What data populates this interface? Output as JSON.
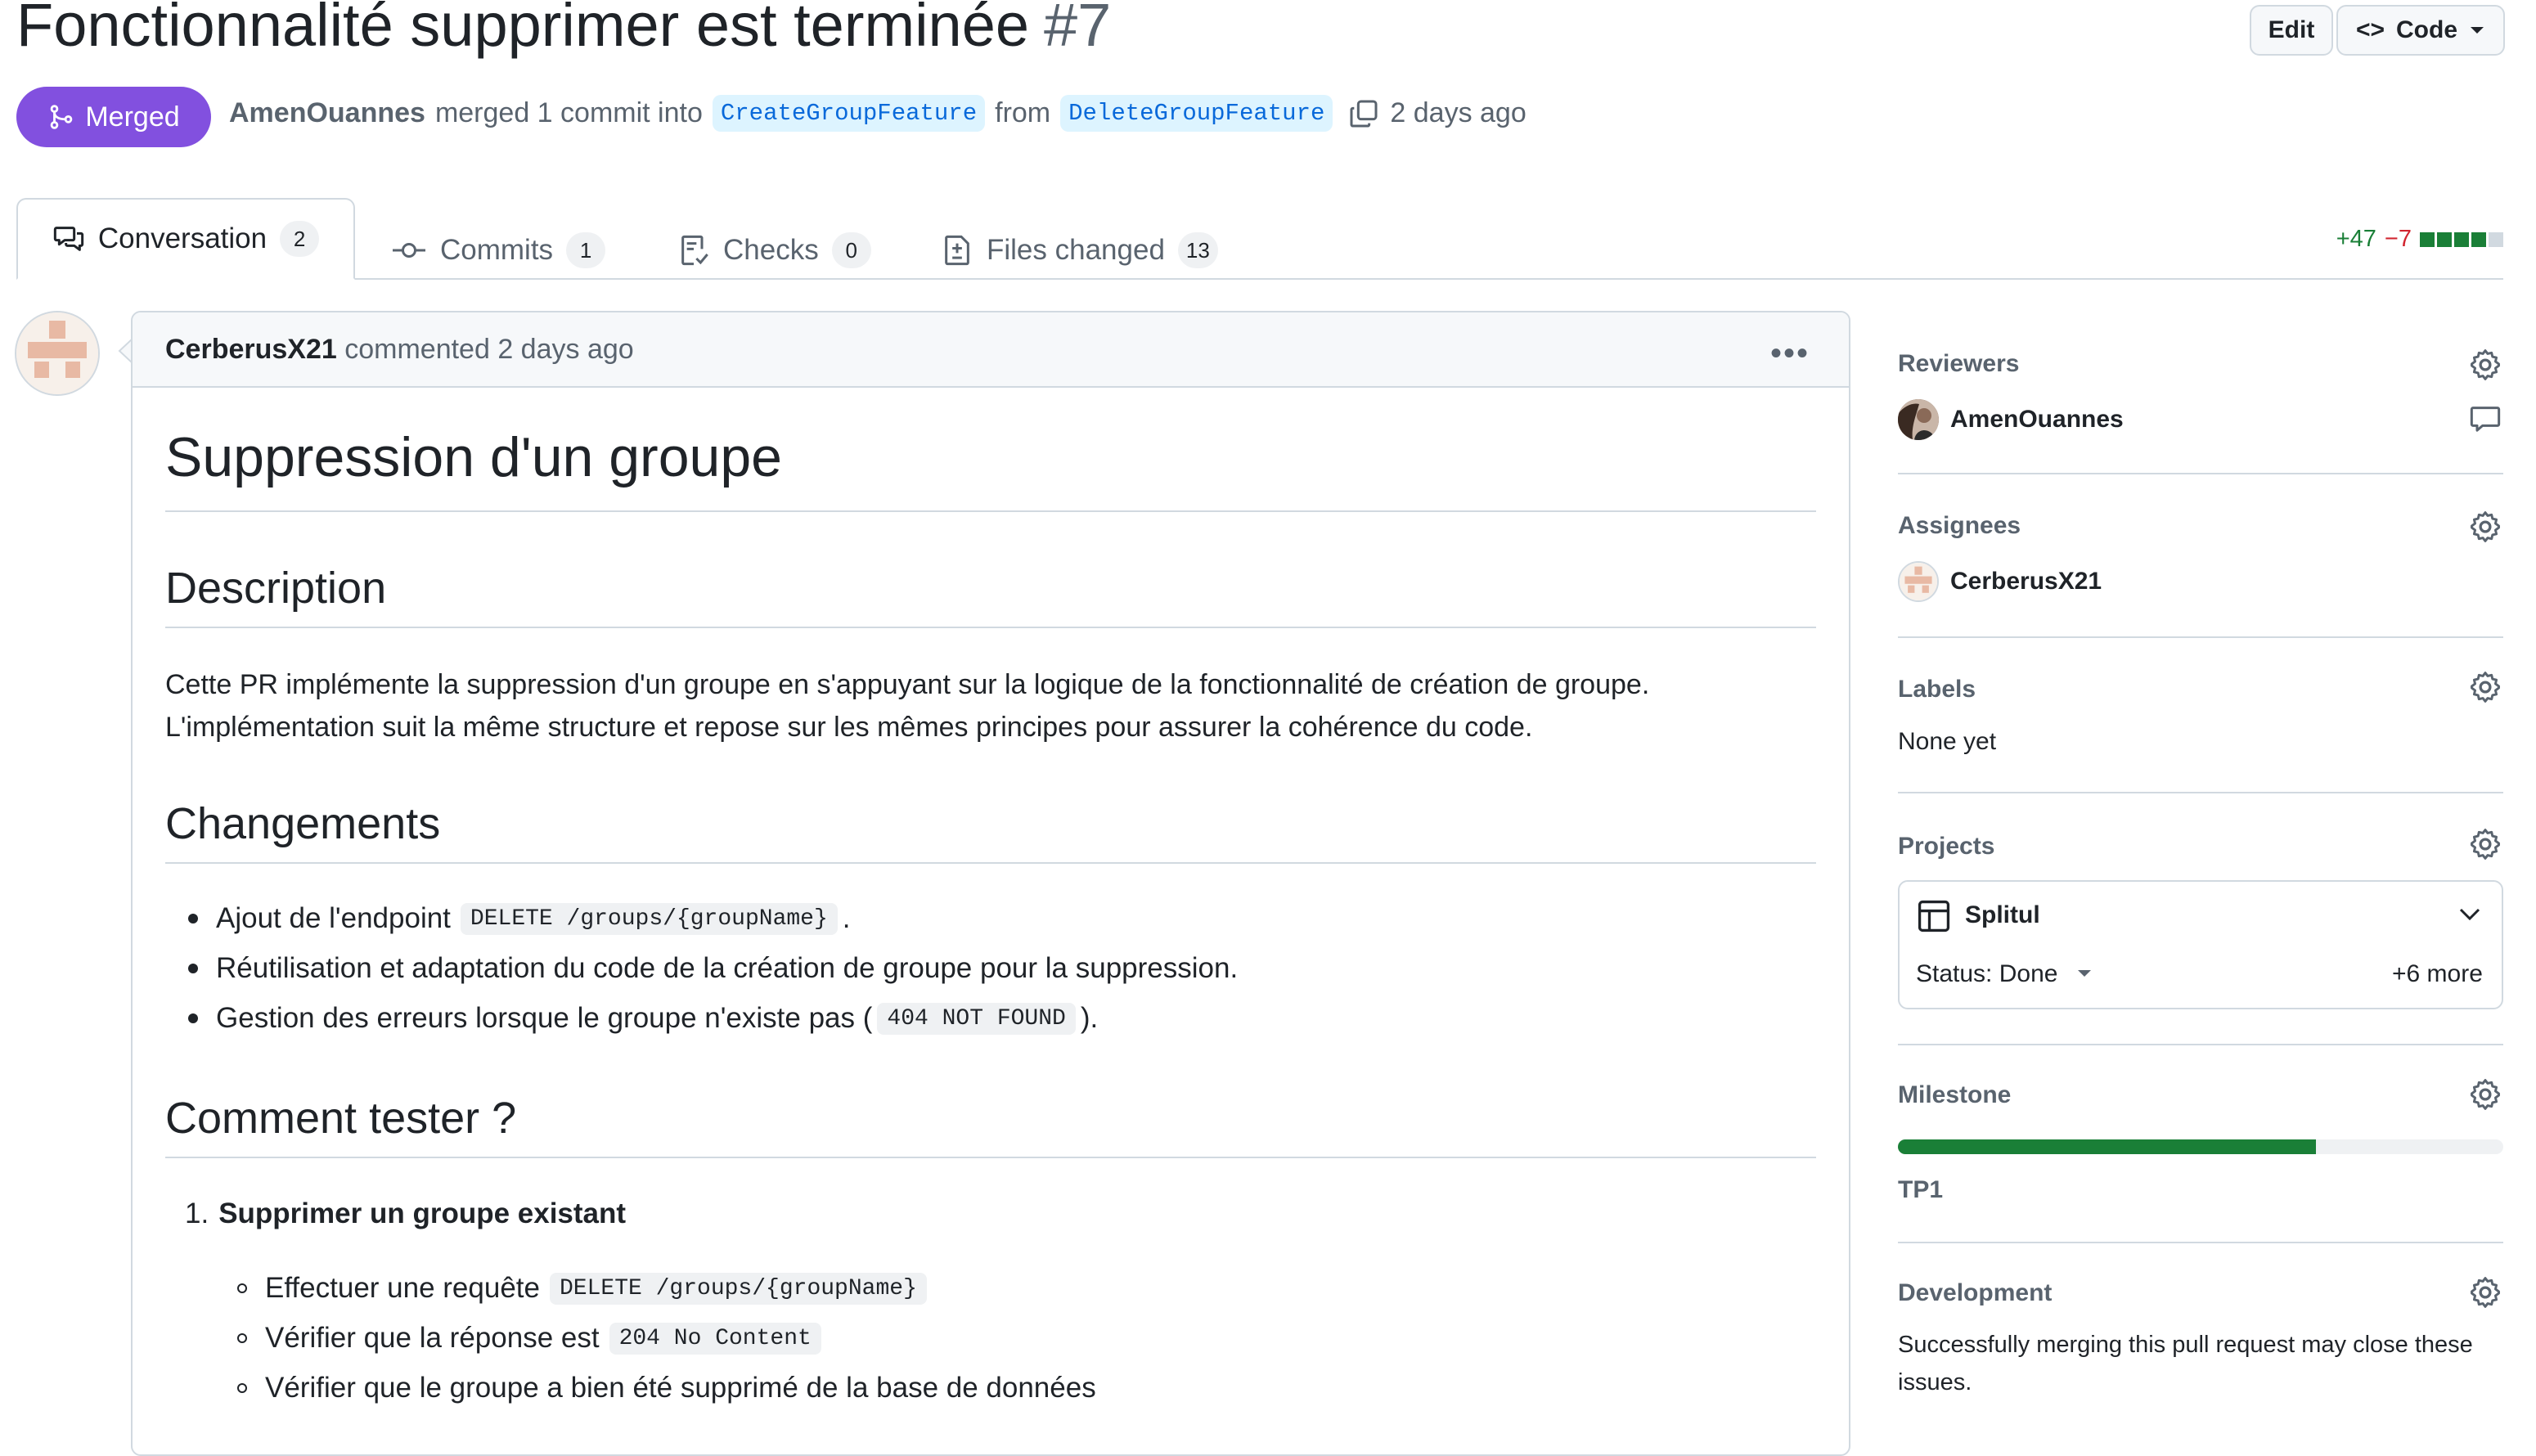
{
  "header": {
    "title": "Fonctionnalité supprimer est terminée",
    "number": "#7",
    "edit_label": "Edit",
    "code_label": "Code"
  },
  "status": {
    "badge": "Merged",
    "author": "AmenOuannes",
    "action": "merged 1 commit into",
    "base_branch": "CreateGroupFeature",
    "from": "from",
    "head_branch": "DeleteGroupFeature",
    "time": "2 days ago"
  },
  "tabs": [
    {
      "label": "Conversation",
      "count": "2"
    },
    {
      "label": "Commits",
      "count": "1"
    },
    {
      "label": "Checks",
      "count": "0"
    },
    {
      "label": "Files changed",
      "count": "13"
    }
  ],
  "diffstat": {
    "additions": "+47",
    "deletions": "−7"
  },
  "comment": {
    "author": "CerberusX21",
    "meta": "commented 2 days ago",
    "heading": "Suppression d'un groupe",
    "description_heading": "Description",
    "description_lines": [
      "Cette PR implémente la suppression d'un groupe en s'appuyant sur la logique de la fonctionnalité de création de groupe.",
      "L'implémentation suit la même structure et repose sur les mêmes principes pour assurer la cohérence du code."
    ],
    "changes_heading": "Changements",
    "change1_pre": "Ajout de l'endpoint",
    "change1_code": "DELETE /groups/{groupName}",
    "change1_post": ".",
    "change2": "Réutilisation et adaptation du code de la création de groupe pour la suppression.",
    "change3_pre": "Gestion des erreurs lorsque le groupe n'existe pas (",
    "change3_code": "404 NOT FOUND",
    "change3_post": ").",
    "test_heading": "Comment tester ?",
    "step1_num": "1.",
    "step1": "Supprimer un groupe existant",
    "sub1_pre": "Effectuer une requête",
    "sub1_code": "DELETE /groups/{groupName}",
    "sub2_pre": "Vérifier que la réponse est",
    "sub2_code": "204 No Content",
    "sub3": "Vérifier que le groupe a bien été supprimé de la base de données"
  },
  "sidebar": {
    "reviewers_label": "Reviewers",
    "reviewer": "AmenOuannes",
    "assignees_label": "Assignees",
    "assignee": "CerberusX21",
    "labels_label": "Labels",
    "labels_value": "None yet",
    "projects_label": "Projects",
    "project_name": "Splitul",
    "project_status": "Status: Done",
    "project_more": "+6 more",
    "milestone_label": "Milestone",
    "milestone_name": "TP1",
    "milestone_progress": 0.69,
    "development_label": "Development",
    "development_line1": "Successfully merging this pull request may close these",
    "development_line2": "issues."
  },
  "colors": {
    "merged": "#8250df",
    "link": "#0969da",
    "addition": "#1a7f37",
    "deletion": "#d1242f",
    "border": "#d1d9e0"
  }
}
